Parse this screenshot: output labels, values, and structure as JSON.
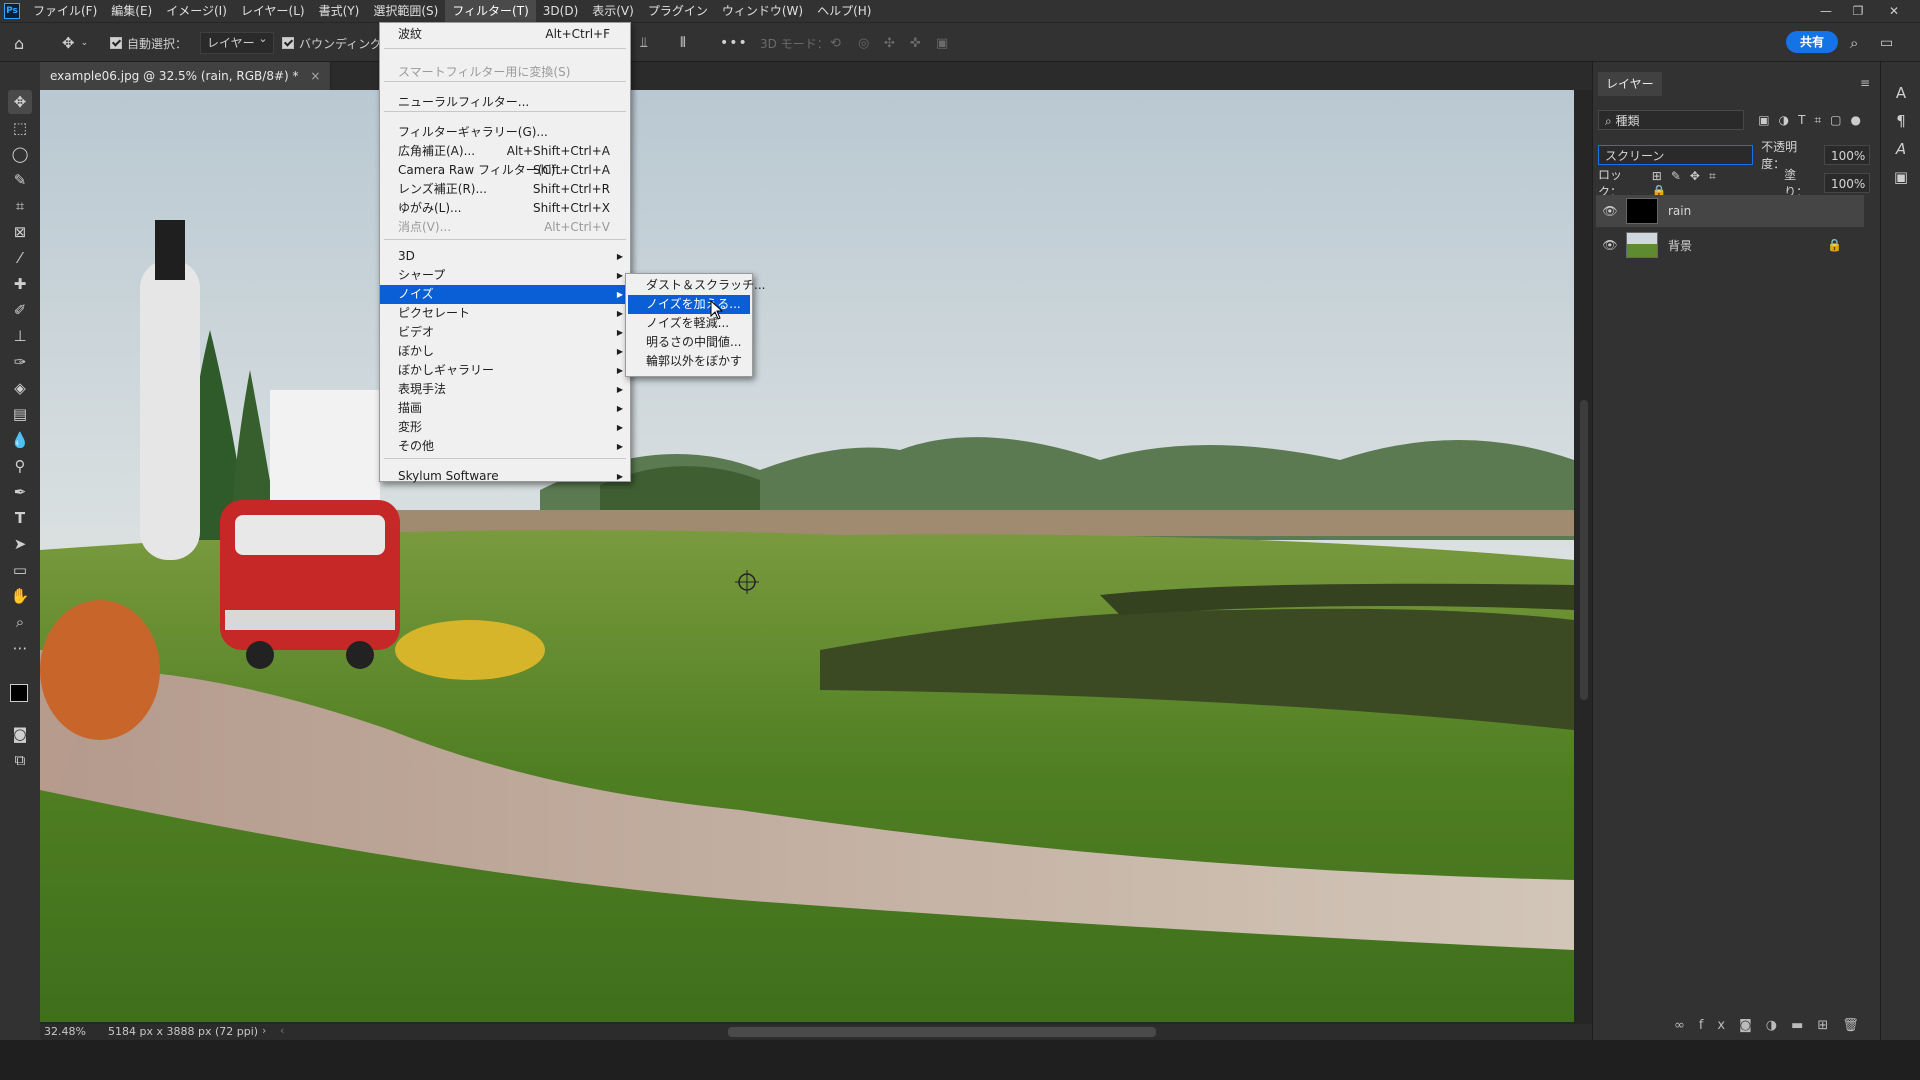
{
  "menubar": {
    "items": [
      "ファイル(F)",
      "編集(E)",
      "イメージ(I)",
      "レイヤー(L)",
      "書式(Y)",
      "選択範囲(S)",
      "フィルター(T)",
      "3D(D)",
      "表示(V)",
      "プラグイン",
      "ウィンドウ(W)",
      "ヘルプ(H)"
    ],
    "active_index": 6
  },
  "options": {
    "auto_select_label": "自動選択：",
    "auto_select_value": "レイヤー",
    "bounding_label": "バウンディングボ",
    "mode_3d_label": "3D モード：",
    "more": "•••"
  },
  "share_label": "共有",
  "document": {
    "tab_title": "example06.jpg @ 32.5% (rain, RGB/8#) *",
    "close": "×",
    "zoom": "32.48%",
    "size_info": "5184 px x 3888 px (72 ppi)"
  },
  "filter_menu": {
    "items": [
      {
        "label": "波紋",
        "shortcut": "Alt+Ctrl+F"
      },
      {
        "label": "スマートフィルター用に変換(S)",
        "disabled": true
      },
      {
        "label": "ニューラルフィルター..."
      },
      {
        "label": "フィルターギャラリー(G)..."
      },
      {
        "label": "広角補正(A)...",
        "shortcut": "Alt+Shift+Ctrl+A"
      },
      {
        "label": "Camera Raw フィルター(C)...",
        "shortcut": "Shift+Ctrl+A"
      },
      {
        "label": "レンズ補正(R)...",
        "shortcut": "Shift+Ctrl+R"
      },
      {
        "label": "ゆがみ(L)...",
        "shortcut": "Shift+Ctrl+X"
      },
      {
        "label": "消点(V)...",
        "shortcut": "Alt+Ctrl+V",
        "disabled": true
      },
      {
        "label": "3D",
        "submenu": true
      },
      {
        "label": "シャープ",
        "submenu": true
      },
      {
        "label": "ノイズ",
        "submenu": true,
        "highlighted": true
      },
      {
        "label": "ピクセレート",
        "submenu": true
      },
      {
        "label": "ビデオ",
        "submenu": true
      },
      {
        "label": "ぼかし",
        "submenu": true
      },
      {
        "label": "ぼかしギャラリー",
        "submenu": true
      },
      {
        "label": "表現手法",
        "submenu": true
      },
      {
        "label": "描画",
        "submenu": true
      },
      {
        "label": "変形",
        "submenu": true
      },
      {
        "label": "その他",
        "submenu": true
      },
      {
        "label": "Skylum Software",
        "submenu": true
      }
    ]
  },
  "noise_submenu": {
    "items": [
      {
        "label": "ダスト＆スクラッチ..."
      },
      {
        "label": "ノイズを加える...",
        "highlighted": true
      },
      {
        "label": "ノイズを軽減..."
      },
      {
        "label": "明るさの中間値..."
      },
      {
        "label": "輪郭以外をぼかす"
      }
    ]
  },
  "layers_panel": {
    "tab": "レイヤー",
    "filter_kind": "種類",
    "blend_mode": "スクリーン",
    "opacity_label": "不透明度：",
    "opacity_value": "100%",
    "lock_label": "ロック：",
    "fill_label": "塗り：",
    "fill_value": "100%",
    "layers": [
      {
        "name": "rain",
        "selected": true
      },
      {
        "name": "背景",
        "locked": true
      }
    ]
  },
  "colors": {
    "accent": "#1473e6",
    "menu_highlight": "#0a5fd6",
    "ps_blue": "#31a8ff"
  }
}
